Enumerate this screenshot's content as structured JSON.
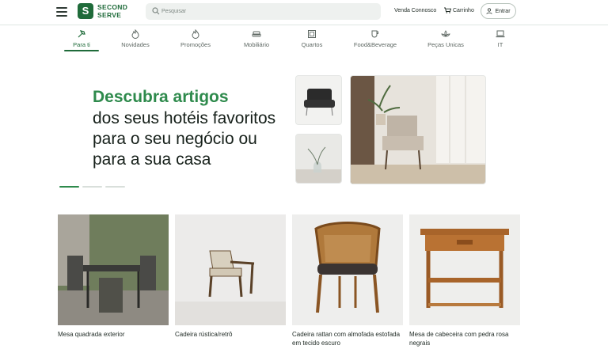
{
  "header": {
    "brand_line1": "SECOND",
    "brand_line2": "SERVE",
    "search_placeholder": "Pesquisar",
    "sell_link": "Venda Connosco",
    "cart_label": "Carrinho",
    "login_label": "Entrar"
  },
  "categories": [
    {
      "label": "Para ti",
      "icon": "hammer-icon",
      "active": true
    },
    {
      "label": "Novidades",
      "icon": "flame-icon",
      "active": false
    },
    {
      "label": "Promoções",
      "icon": "flame-icon",
      "active": false
    },
    {
      "label": "Mobiliário",
      "icon": "sofa-icon",
      "active": false
    },
    {
      "label": "Quartos",
      "icon": "safe-icon",
      "active": false
    },
    {
      "label": "Food&Beverage",
      "icon": "cup-icon",
      "active": false
    },
    {
      "label": "Peças Unicas",
      "icon": "lotus-icon",
      "active": false
    },
    {
      "label": "IT",
      "icon": "laptop-icon",
      "active": false
    }
  ],
  "hero": {
    "title_accent": "Descubra artigos",
    "title_rest": "dos seus hotéis favoritos para o seu negócio ou para a sua casa"
  },
  "products": [
    {
      "name": "Mesa quadrada exterior"
    },
    {
      "name": "Cadeira rústica/retrô"
    },
    {
      "name": "Cadeira rattan com almofada estofada em tecido escuro"
    },
    {
      "name": "Mesa de cabeceira com pedra rosa negrais"
    }
  ],
  "colors": {
    "brand": "#1f6b3a",
    "accent": "#2e8a4c"
  }
}
